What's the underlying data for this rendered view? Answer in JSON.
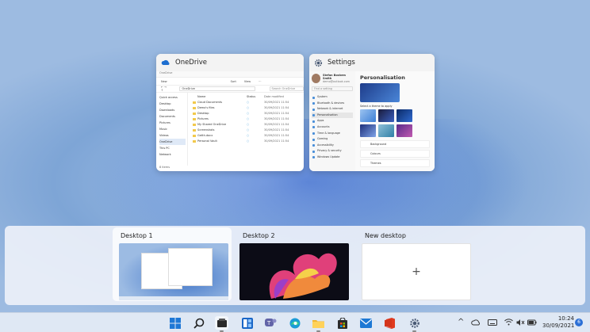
{
  "windows": {
    "onedrive": {
      "title": "OneDrive",
      "explorer": {
        "titlebar": "OneDrive",
        "toolbar": [
          "New",
          "Sort",
          "View",
          "···"
        ],
        "address": "OneDrive",
        "search_placeholder": "Search OneDrive",
        "nav": [
          "Quick access",
          "Desktop",
          "Downloads",
          "Documents",
          "Pictures",
          "Music",
          "Videos",
          "OneDrive",
          "This PC",
          "Network"
        ],
        "columns": [
          "Name",
          "Status",
          "Date modified"
        ],
        "rows": [
          [
            "Cloud Documents",
            "○",
            "30/09/2021 11:54"
          ],
          [
            "Demo's files",
            "○",
            "30/09/2021 11:54"
          ],
          [
            "Desktop",
            "○",
            "30/09/2021 11:54"
          ],
          [
            "Pictures",
            "○",
            "30/09/2021 11:54"
          ],
          [
            "My Shared OneDrive",
            "○",
            "30/09/2021 11:54"
          ],
          [
            "Screenshots",
            "○",
            "30/09/2021 11:54"
          ],
          [
            "Getth.docx",
            "○",
            "30/09/2021 11:54"
          ],
          [
            "Personal Vault",
            "○",
            "30/09/2021 11:54"
          ]
        ],
        "status": "8 items"
      }
    },
    "settings": {
      "title": "Settings",
      "user_name": "Stefan Boshem Smith",
      "user_email": "demo@outlook.com",
      "find_placeholder": "Find a setting",
      "nav": [
        "System",
        "Bluetooth & devices",
        "Network & internet",
        "Personalisation",
        "Apps",
        "Accounts",
        "Time & language",
        "Gaming",
        "Accessibility",
        "Privacy & security",
        "Windows Update"
      ],
      "heading": "Personalisation",
      "theme_prompt": "Select a theme to apply",
      "cards": [
        "Background",
        "Colours",
        "Themes"
      ]
    }
  },
  "desktops": [
    {
      "label": "Desktop 1"
    },
    {
      "label": "Desktop 2"
    },
    {
      "label": "New desktop",
      "add_symbol": "+"
    }
  ],
  "taskbar": {
    "apps": [
      "windows-start",
      "search",
      "file-explorer-active",
      "widgets",
      "teams-chat",
      "edge",
      "file-explorer",
      "store",
      "mail",
      "office",
      "settings"
    ],
    "tray": {
      "chevron": "^",
      "notification_count": "6"
    },
    "clock": {
      "time": "10:24",
      "date": "30/09/2021"
    }
  }
}
